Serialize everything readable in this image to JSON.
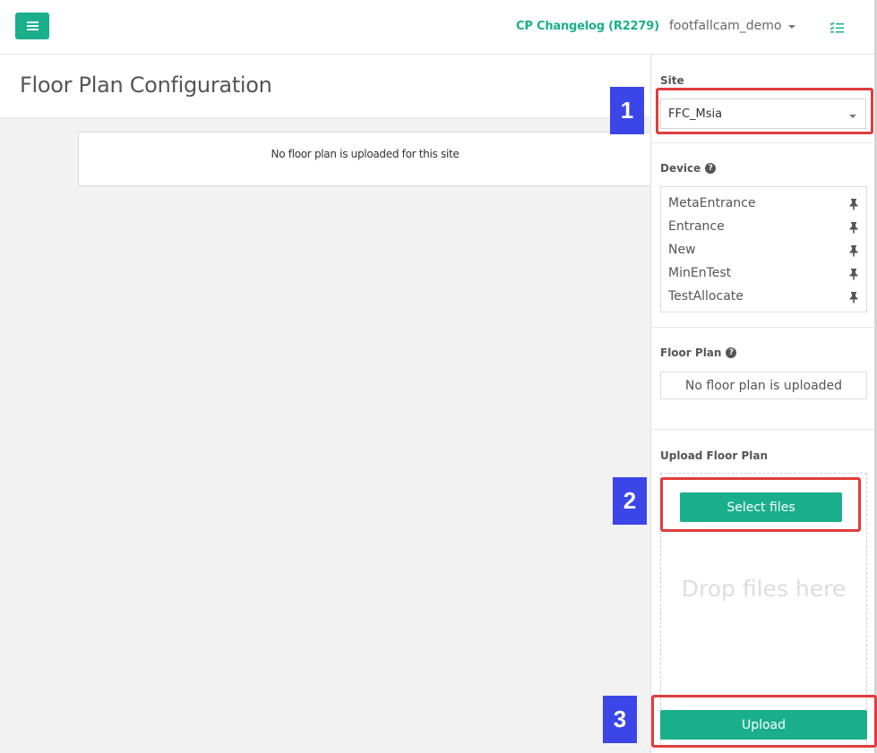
{
  "header": {
    "changelog": "CP Changelog (R2279)",
    "username": "footfallcam_demo"
  },
  "page": {
    "title": "Floor Plan Configuration",
    "no_plan_message": "No floor plan is uploaded for this site"
  },
  "sidebar": {
    "site_label": "Site",
    "site_value": "FFC_Msia",
    "device_label": "Device",
    "devices": [
      "MetaEntrance",
      "Entrance",
      "New",
      "MinEnTest",
      "TestAllocate"
    ],
    "floor_plan_label": "Floor Plan",
    "floor_plan_status": "No floor plan is uploaded",
    "upload_label": "Upload Floor Plan",
    "select_files": "Select files",
    "drop_text": "Drop files here",
    "upload_button": "Upload"
  },
  "callouts": [
    "1",
    "2",
    "3"
  ],
  "colors": {
    "accent": "#1aaf8b",
    "callout_number": "#3b45e8",
    "callout_border": "#e03c3c"
  }
}
